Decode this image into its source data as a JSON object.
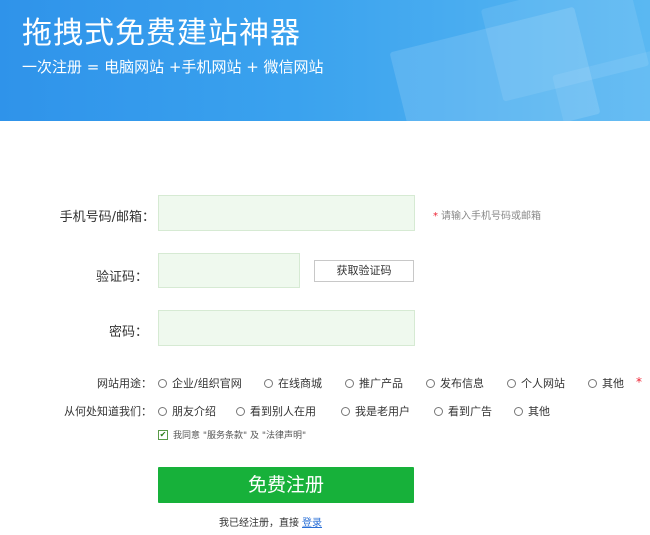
{
  "banner": {
    "title": "拖拽式免费建站神器",
    "subtitle": "一次注册 = 电脑网站 +手机网站 + 微信网站"
  },
  "form": {
    "phone_label": "手机号码/邮箱：",
    "phone_hint_star": "*",
    "phone_hint": "请输入手机号码或邮箱",
    "code_label": "验证码：",
    "code_button": "获取验证码",
    "password_label": "密码："
  },
  "usage": {
    "label": "网站用途：",
    "options": [
      "企业/组织官网",
      "在线商城",
      "推广产品",
      "发布信息",
      "个人网站",
      "其他"
    ],
    "required_star": "*"
  },
  "source": {
    "label": "从何处知道我们：",
    "options": [
      "朋友介绍",
      "看到别人在用",
      "我是老用户",
      "看到广告",
      "其他"
    ]
  },
  "agreement": {
    "checked": true,
    "text": "我同意 \"服务条款\" 及 \"法律声明\""
  },
  "submit_label": "免费注册",
  "login": {
    "prefix": "我已经注册，直接",
    "link": "登录"
  },
  "colors": {
    "banner": "#3aa2ee",
    "submit": "#17b13a",
    "input_bg": "#eff9ee",
    "required": "#e23333",
    "link": "#2a6fd6"
  }
}
